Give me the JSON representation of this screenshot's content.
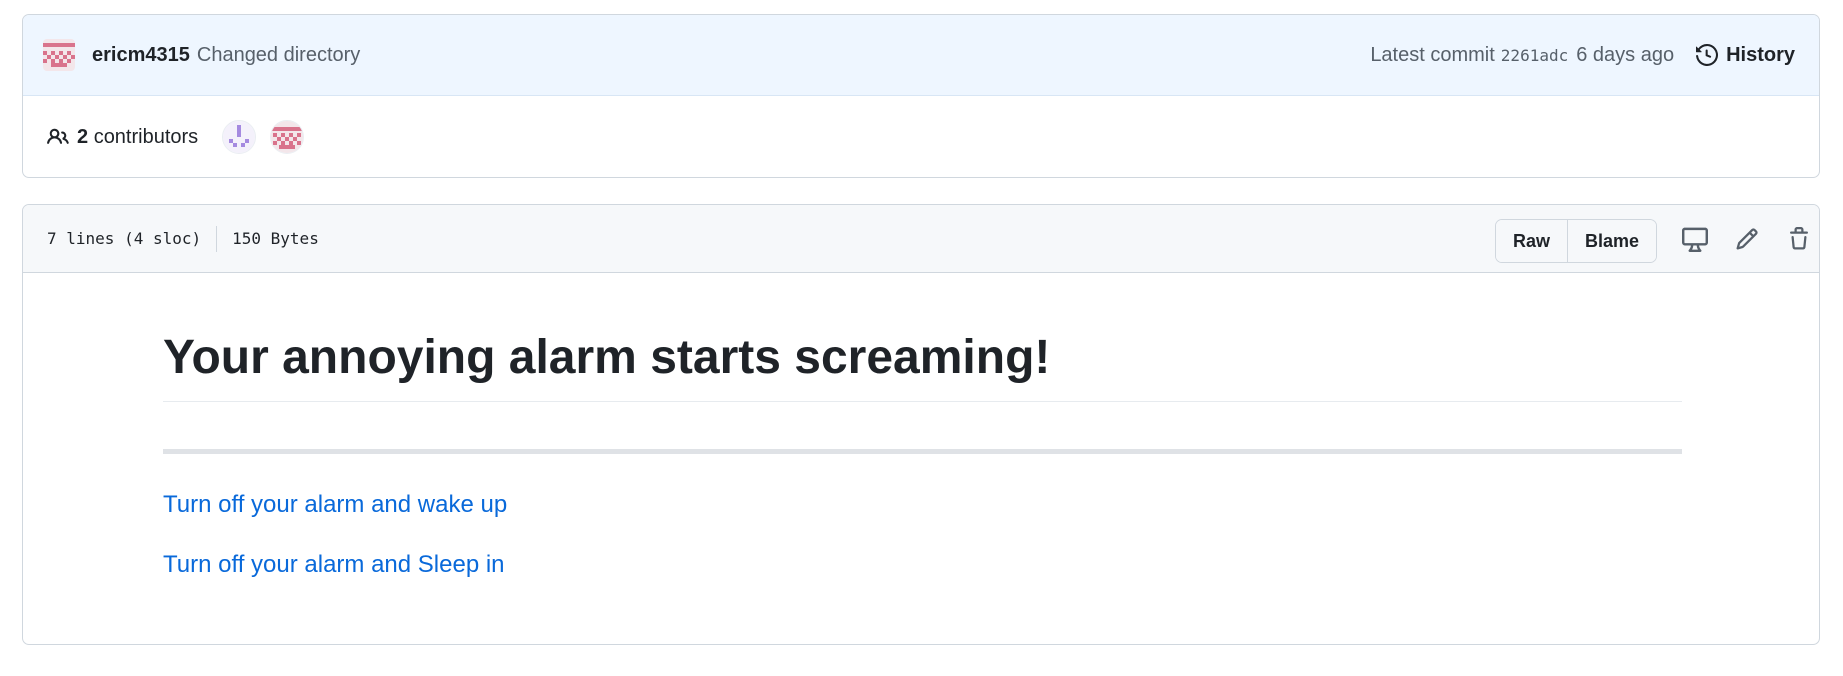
{
  "commit": {
    "author": "ericm4315",
    "message": "Changed directory",
    "latest_label": "Latest commit",
    "sha": "2261adc",
    "age": "6 days ago",
    "history_label": "History"
  },
  "contributors": {
    "count": "2",
    "label": "contributors"
  },
  "file": {
    "lines_info": "7 lines (4 sloc)",
    "size": "150 Bytes",
    "raw_label": "Raw",
    "blame_label": "Blame"
  },
  "content": {
    "heading": "Your annoying alarm starts screaming!",
    "links": [
      "Turn off your alarm and wake up",
      "Turn off your alarm and Sleep in"
    ]
  },
  "colors": {
    "link": "#0969da",
    "header_bg": "#eef6ff",
    "avatar_red": "#d9738c",
    "avatar_purple": "#a58ae0"
  },
  "icons": [
    "people-icon",
    "history-icon",
    "display-icon",
    "pencil-icon",
    "trash-icon"
  ]
}
